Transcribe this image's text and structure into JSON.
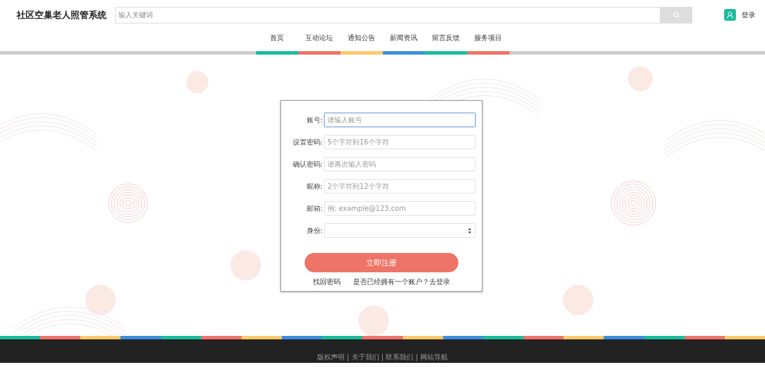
{
  "header": {
    "site_title": "社区空巢老人照管系统",
    "search": {
      "placeholder": "输入关键词"
    },
    "login_link": "登录"
  },
  "nav": [
    {
      "label": "首页",
      "color": "#1abc9c"
    },
    {
      "label": "互动论坛",
      "color": "#ef7468"
    },
    {
      "label": "通知公告",
      "color": "#fdc96a"
    },
    {
      "label": "新闻资讯",
      "color": "#3a8fdb"
    },
    {
      "label": "留言反馈",
      "color": "#1abc9c"
    },
    {
      "label": "服务项目",
      "color": "#ef7468"
    }
  ],
  "form": {
    "fields": [
      {
        "label": "账号:",
        "placeholder": "请输入账号",
        "kind": "text",
        "focused": true
      },
      {
        "label": "设置密码:",
        "placeholder": "5个字符到16个字符",
        "kind": "text",
        "focused": false
      },
      {
        "label": "确认密码:",
        "placeholder": "请再次输入密码",
        "kind": "text",
        "focused": false
      },
      {
        "label": "昵称:",
        "placeholder": "2个字符到12个字符",
        "kind": "text",
        "focused": false
      },
      {
        "label": "邮箱:",
        "placeholder": "例: example@123.com",
        "kind": "text",
        "focused": false
      },
      {
        "label": "身份:",
        "kind": "select",
        "focused": false
      }
    ],
    "submit": "立即注册",
    "forgot_link": "找回密码",
    "login_prompt": "是否已经拥有一个账户？去登录"
  },
  "footer": {
    "links": "版权声明 | 关于我们 | 联系我们 | 网站导航"
  }
}
